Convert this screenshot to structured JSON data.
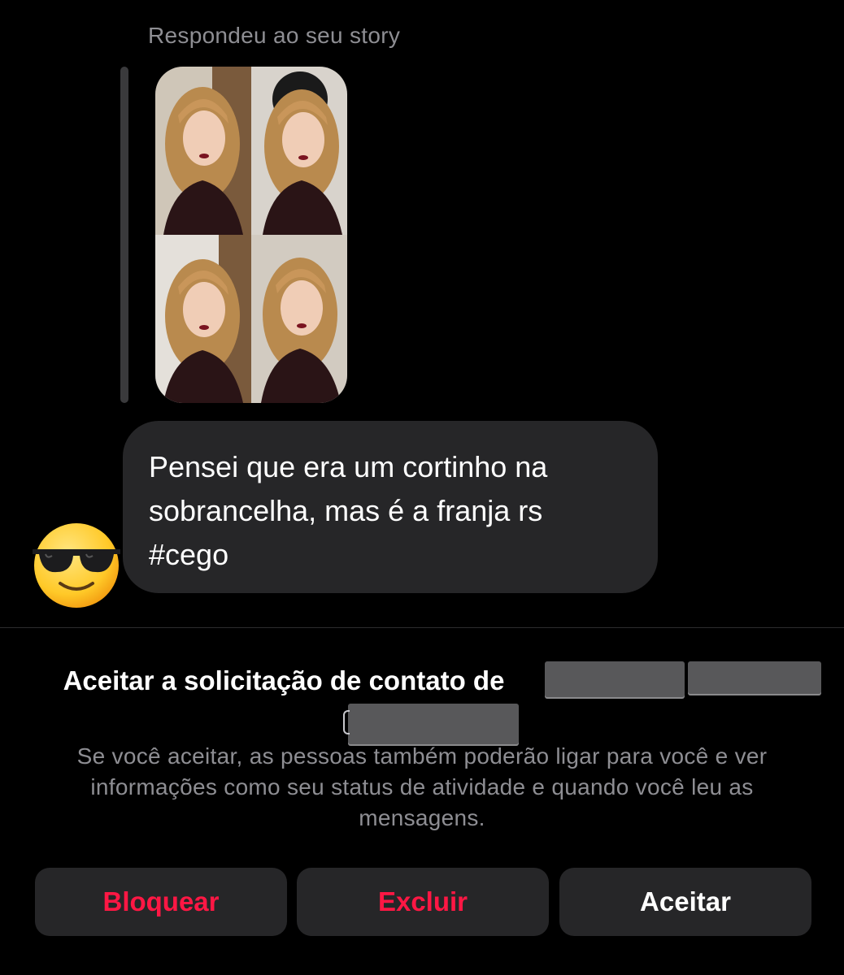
{
  "thread": {
    "reply_caption": "Respondeu ao seu story",
    "message_text": "Pensei que era um cortinho na\nsobrancelha, mas é a franja rs\n#cego",
    "avatar_icon": "smiling-face-with-sunglasses-icon"
  },
  "request": {
    "title": "Aceitar a solicitação de contato de",
    "description": "Se você aceitar, as pessoas também poderão ligar para você e ver informações como seu status de atividade e quando você leu as mensagens."
  },
  "actions": {
    "block_label": "Bloquear",
    "delete_label": "Excluir",
    "accept_label": "Aceitar"
  },
  "colors": {
    "background": "#000000",
    "bubble": "#262628",
    "destructive": "#ff1744",
    "secondary_text": "#8e8e93"
  }
}
